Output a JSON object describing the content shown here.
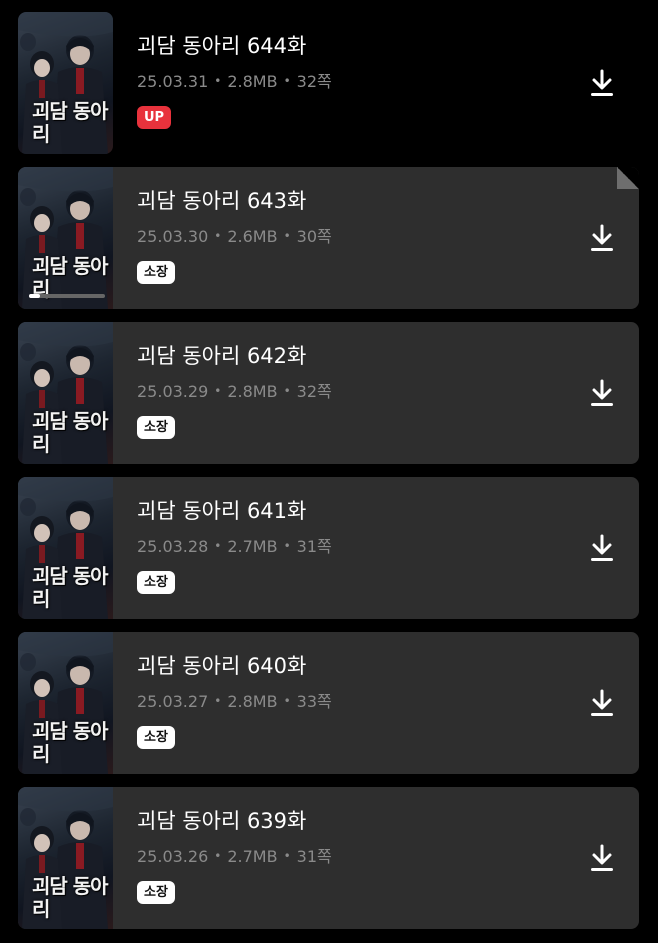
{
  "colors": {
    "background": "#000000",
    "card": "#2e2e2e",
    "up_badge": "#e8323c",
    "owned_badge": "#ffffff",
    "meta_text": "#8a8a8a"
  },
  "episodes": [
    {
      "title": "괴담 동아리 644화",
      "date": "25.03.31",
      "size": "2.8MB",
      "pages": "32쪽",
      "badge": "UP",
      "badge_type": "up",
      "thumb_title": "괴담 동아리",
      "progress": null,
      "card": false,
      "icon": "download-icon"
    },
    {
      "title": "괴담 동아리 643화",
      "date": "25.03.30",
      "size": "2.6MB",
      "pages": "30쪽",
      "badge": "소장",
      "badge_type": "own",
      "thumb_title": "괴담 동아리",
      "progress": 0.14,
      "card": true,
      "icon": "download-icon"
    },
    {
      "title": "괴담 동아리 642화",
      "date": "25.03.29",
      "size": "2.8MB",
      "pages": "32쪽",
      "badge": "소장",
      "badge_type": "own",
      "thumb_title": "괴담 동아리",
      "progress": null,
      "card": true,
      "icon": "download-icon"
    },
    {
      "title": "괴담 동아리 641화",
      "date": "25.03.28",
      "size": "2.7MB",
      "pages": "31쪽",
      "badge": "소장",
      "badge_type": "own",
      "thumb_title": "괴담 동아리",
      "progress": null,
      "card": true,
      "icon": "download-icon"
    },
    {
      "title": "괴담 동아리 640화",
      "date": "25.03.27",
      "size": "2.8MB",
      "pages": "33쪽",
      "badge": "소장",
      "badge_type": "own",
      "thumb_title": "괴담 동아리",
      "progress": null,
      "card": true,
      "icon": "download-icon"
    },
    {
      "title": "괴담 동아리 639화",
      "date": "25.03.26",
      "size": "2.7MB",
      "pages": "31쪽",
      "badge": "소장",
      "badge_type": "own",
      "thumb_title": "괴담 동아리",
      "progress": null,
      "card": true,
      "icon": "download-icon"
    }
  ]
}
